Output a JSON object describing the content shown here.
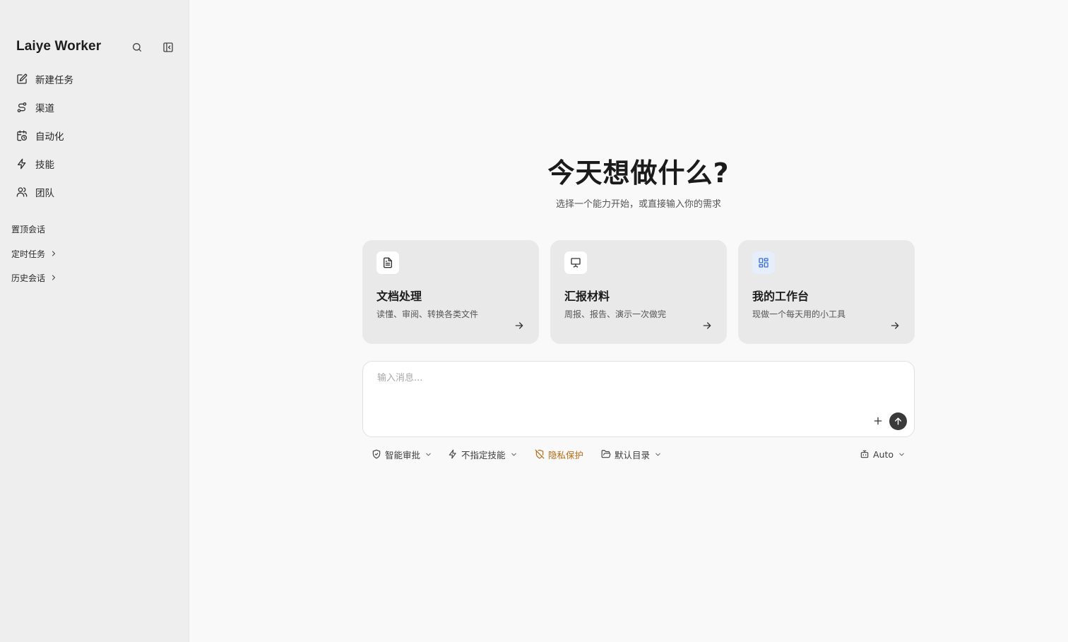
{
  "sidebar": {
    "brand": "Laiye Worker",
    "nav": [
      {
        "label": "新建任务",
        "icon": "edit-icon"
      },
      {
        "label": "渠道",
        "icon": "route-icon"
      },
      {
        "label": "自动化",
        "icon": "calendar-clock-icon"
      },
      {
        "label": "技能",
        "icon": "lightning-icon"
      },
      {
        "label": "团队",
        "icon": "users-icon"
      }
    ],
    "sections": {
      "pinned": "置顶会话",
      "scheduled": "定时任务",
      "history": "历史会话"
    }
  },
  "main": {
    "headline": "今天想做什么?",
    "subline": "选择一个能力开始，或直接输入你的需求",
    "cards": [
      {
        "title": "文档处理",
        "desc": "读懂、审阅、转换各类文件",
        "icon": "document-icon"
      },
      {
        "title": "汇报材料",
        "desc": "周报、报告、演示一次做完",
        "icon": "presentation-icon"
      },
      {
        "title": "我的工作台",
        "desc": "现做一个每天用的小工具",
        "icon": "dashboard-grid-icon"
      }
    ],
    "composer": {
      "placeholder": "输入消息..."
    },
    "toolbar": {
      "approval": "智能审批",
      "skill": "不指定技能",
      "privacy": "隐私保护",
      "directory": "默认目录",
      "model": "Auto"
    }
  },
  "colors": {
    "sidebar_bg": "#eeeeee",
    "page_bg": "#f9f9f9",
    "card_bg": "#e9e9ea",
    "privacy_accent": "#b96a12",
    "send_button": "#3a3a3a"
  }
}
